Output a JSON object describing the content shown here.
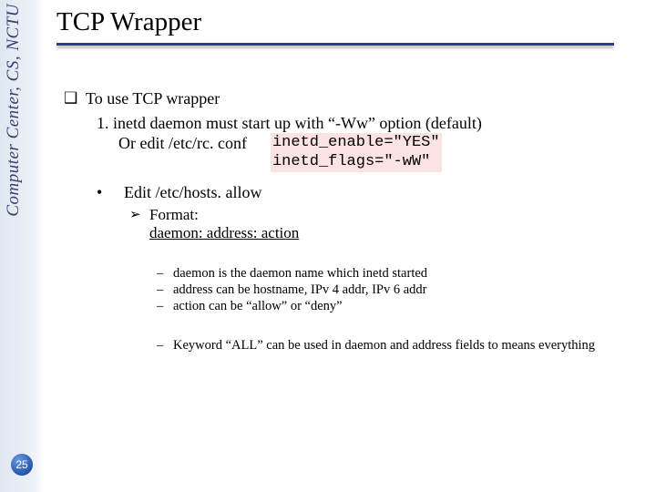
{
  "sidebar": {
    "org_text": "Computer Center, CS, NCTU",
    "page_number": "25"
  },
  "title": "TCP Wrapper",
  "bullet_l1": "To use TCP wrapper",
  "step1_a": "1.   inetd daemon must start up with “-Ww” option (default)",
  "step1_b": "Or edit /etc/rc. conf",
  "code_line1": "inetd_enable=\"YES\"",
  "code_line2": "inetd_flags=\"-wW\"",
  "edit_hosts": "Edit /etc/hosts. allow",
  "format_label": "Format:",
  "format_line": "daemon: address: action",
  "dash1": "daemon is the daemon name which inetd started",
  "dash2": "address can be hostname, IPv 4 addr, IPv 6 addr",
  "dash3": "action can be “allow” or “deny”",
  "dash4": "Keyword “ALL” can be used in daemon and address fields to means everything"
}
